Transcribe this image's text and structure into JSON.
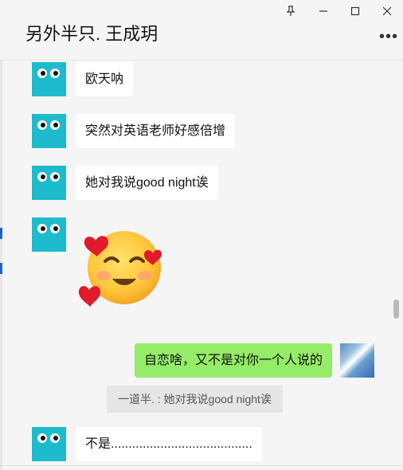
{
  "window": {
    "title": "另外半只. 王成玥",
    "more_label": "•••"
  },
  "messages": [
    {
      "side": "left",
      "text": "欧天呐"
    },
    {
      "side": "left",
      "text": "突然对英语老师好感倍增"
    },
    {
      "side": "left",
      "text": "她对我说good night诶"
    },
    {
      "side": "left",
      "type": "sticker",
      "sticker": "smiling-face-with-hearts"
    },
    {
      "side": "right",
      "text": "自恋啥，又不是对你一个人说的",
      "quote": "一道半. : 她对我说good night诶"
    },
    {
      "side": "left",
      "text": "不是........................................"
    }
  ],
  "colors": {
    "accent_avatar": "#1dbbcb",
    "sent_bubble": "#95ec69",
    "received_bubble": "#ffffff",
    "background": "#f5f5f5"
  },
  "icons": [
    "pin-icon",
    "minimize-icon",
    "maximize-icon",
    "close-icon",
    "more-icon"
  ]
}
